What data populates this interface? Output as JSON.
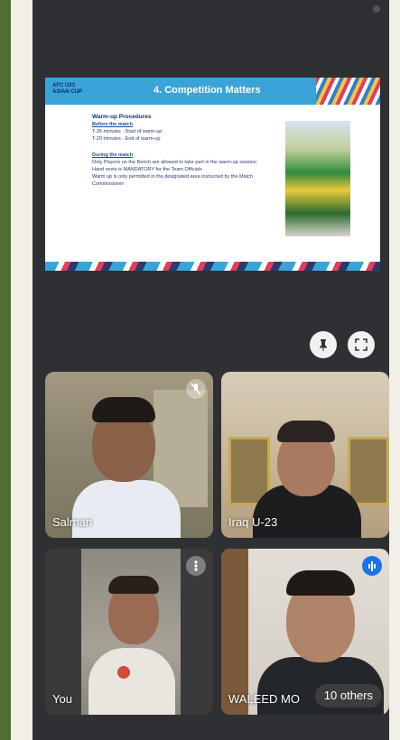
{
  "slide": {
    "logo_text": "AFC U23 ASIAN CUP",
    "title": "4. Competition Matters",
    "section1_title": "Warm-up Procedures",
    "section1_sub": "Before the match",
    "row1": "T-35 minutes  ·  Start of warm-up",
    "row2": "T-20 minutes  ·  End of warm-up",
    "section2_sub": "During the match",
    "bullet1": "Only Players on the Bench are allowed to take part in the warm-up session",
    "bullet2": "Hand vests is MANDATORY for the Team Officials",
    "bullet3": "Warm up is only permitted in the designated area instructed by the Match Commissioner"
  },
  "controls": {
    "pin_icon": "pin-icon",
    "fullscreen_icon": "fullscreen-icon"
  },
  "participants": [
    {
      "name": "Salman",
      "icon": "mic-off-icon"
    },
    {
      "name": "Iraq U-23",
      "icon": ""
    },
    {
      "name": "You",
      "icon": "more-icon"
    },
    {
      "name": "WALEED MO",
      "icon": "speaking-icon"
    }
  ],
  "others_count": "10 others",
  "colors": {
    "accent": "#3aa4d8",
    "speaking": "#1a73e8",
    "background": "#2f3033"
  }
}
